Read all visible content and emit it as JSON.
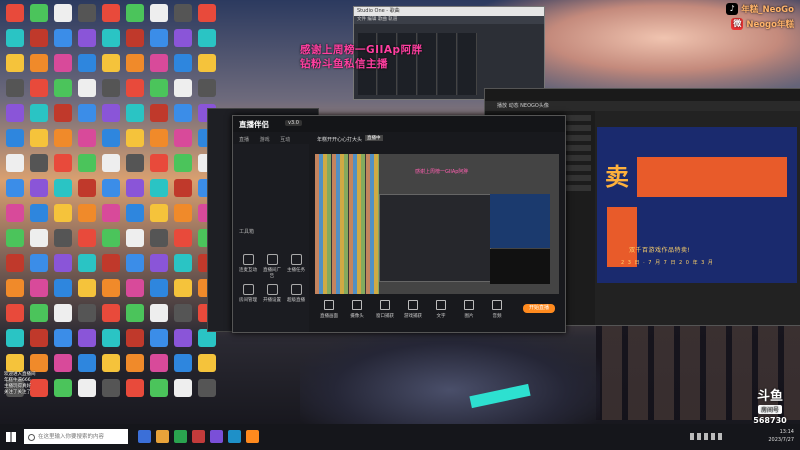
{
  "overlay": {
    "line1": "感谢上周榜一GIIAp阿胖",
    "line2": "钻粉斗鱼私信主播"
  },
  "social": {
    "douyin": "年糕_NeoGo",
    "weibo": "Neogo年糕"
  },
  "studio": {
    "brand": "直播伴侣",
    "version": "v3.0",
    "tabs": [
      "直播",
      "游戏",
      "互动"
    ],
    "live_title": "年糕开开心心打大头",
    "live_tag": "直播中",
    "sidebar_items": [
      "工具箱"
    ],
    "tools": [
      "连麦互动",
      "直播间广告",
      "主播任务",
      "房间管理",
      "开播设置",
      "超级直播"
    ],
    "bottom": [
      "直播画面",
      "摄像头",
      "窗口捕获",
      "游戏捕获",
      "文字",
      "图片",
      "音频"
    ],
    "go_live": "开始直播"
  },
  "right_window": {
    "nav": "播放   动态   NEOGO头像",
    "banner_big": "卖",
    "banner_sub": "双千百游戏作品特卖!",
    "banner_date": "2 3 日 · 7 月 7 日 2 0 年 3 月"
  },
  "mixer": {
    "title": "Studio One - 歌曲",
    "menu": "文件  编辑  歌曲  轨道"
  },
  "danmaku": [
    "欢迎进入直播间",
    "年糕牛逼666",
    "主播玩得真好",
    "关注了关注了"
  ],
  "room": {
    "logo": "斗鱼",
    "label": "房间号",
    "number": "568730"
  },
  "taskbar": {
    "search_placeholder": "在这里输入你要搜索的内容",
    "time": "13:14",
    "date": "2023/7/27"
  },
  "colors": {
    "overlay_pink": "#ff3fa0",
    "social_orange": "#ffb36a",
    "go_live": "#ff8a1e",
    "banner_blue": "#1a2a6e"
  }
}
